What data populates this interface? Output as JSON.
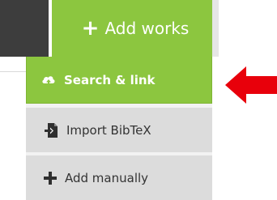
{
  "header": {
    "add_works_label": "Add works"
  },
  "menu": {
    "items": [
      {
        "label": "Search & link",
        "icon": "cloud-icon"
      },
      {
        "label": "Import BibTeX",
        "icon": "import-file-icon"
      },
      {
        "label": "Add manually",
        "icon": "plus-icon"
      }
    ]
  },
  "annotation": {
    "arrow_color": "#e8000b",
    "points_to": "Search & link"
  },
  "colors": {
    "accent_green": "#8cc63f",
    "menu_gray": "#dcdcdc",
    "dark_block": "#3d3d3d"
  }
}
